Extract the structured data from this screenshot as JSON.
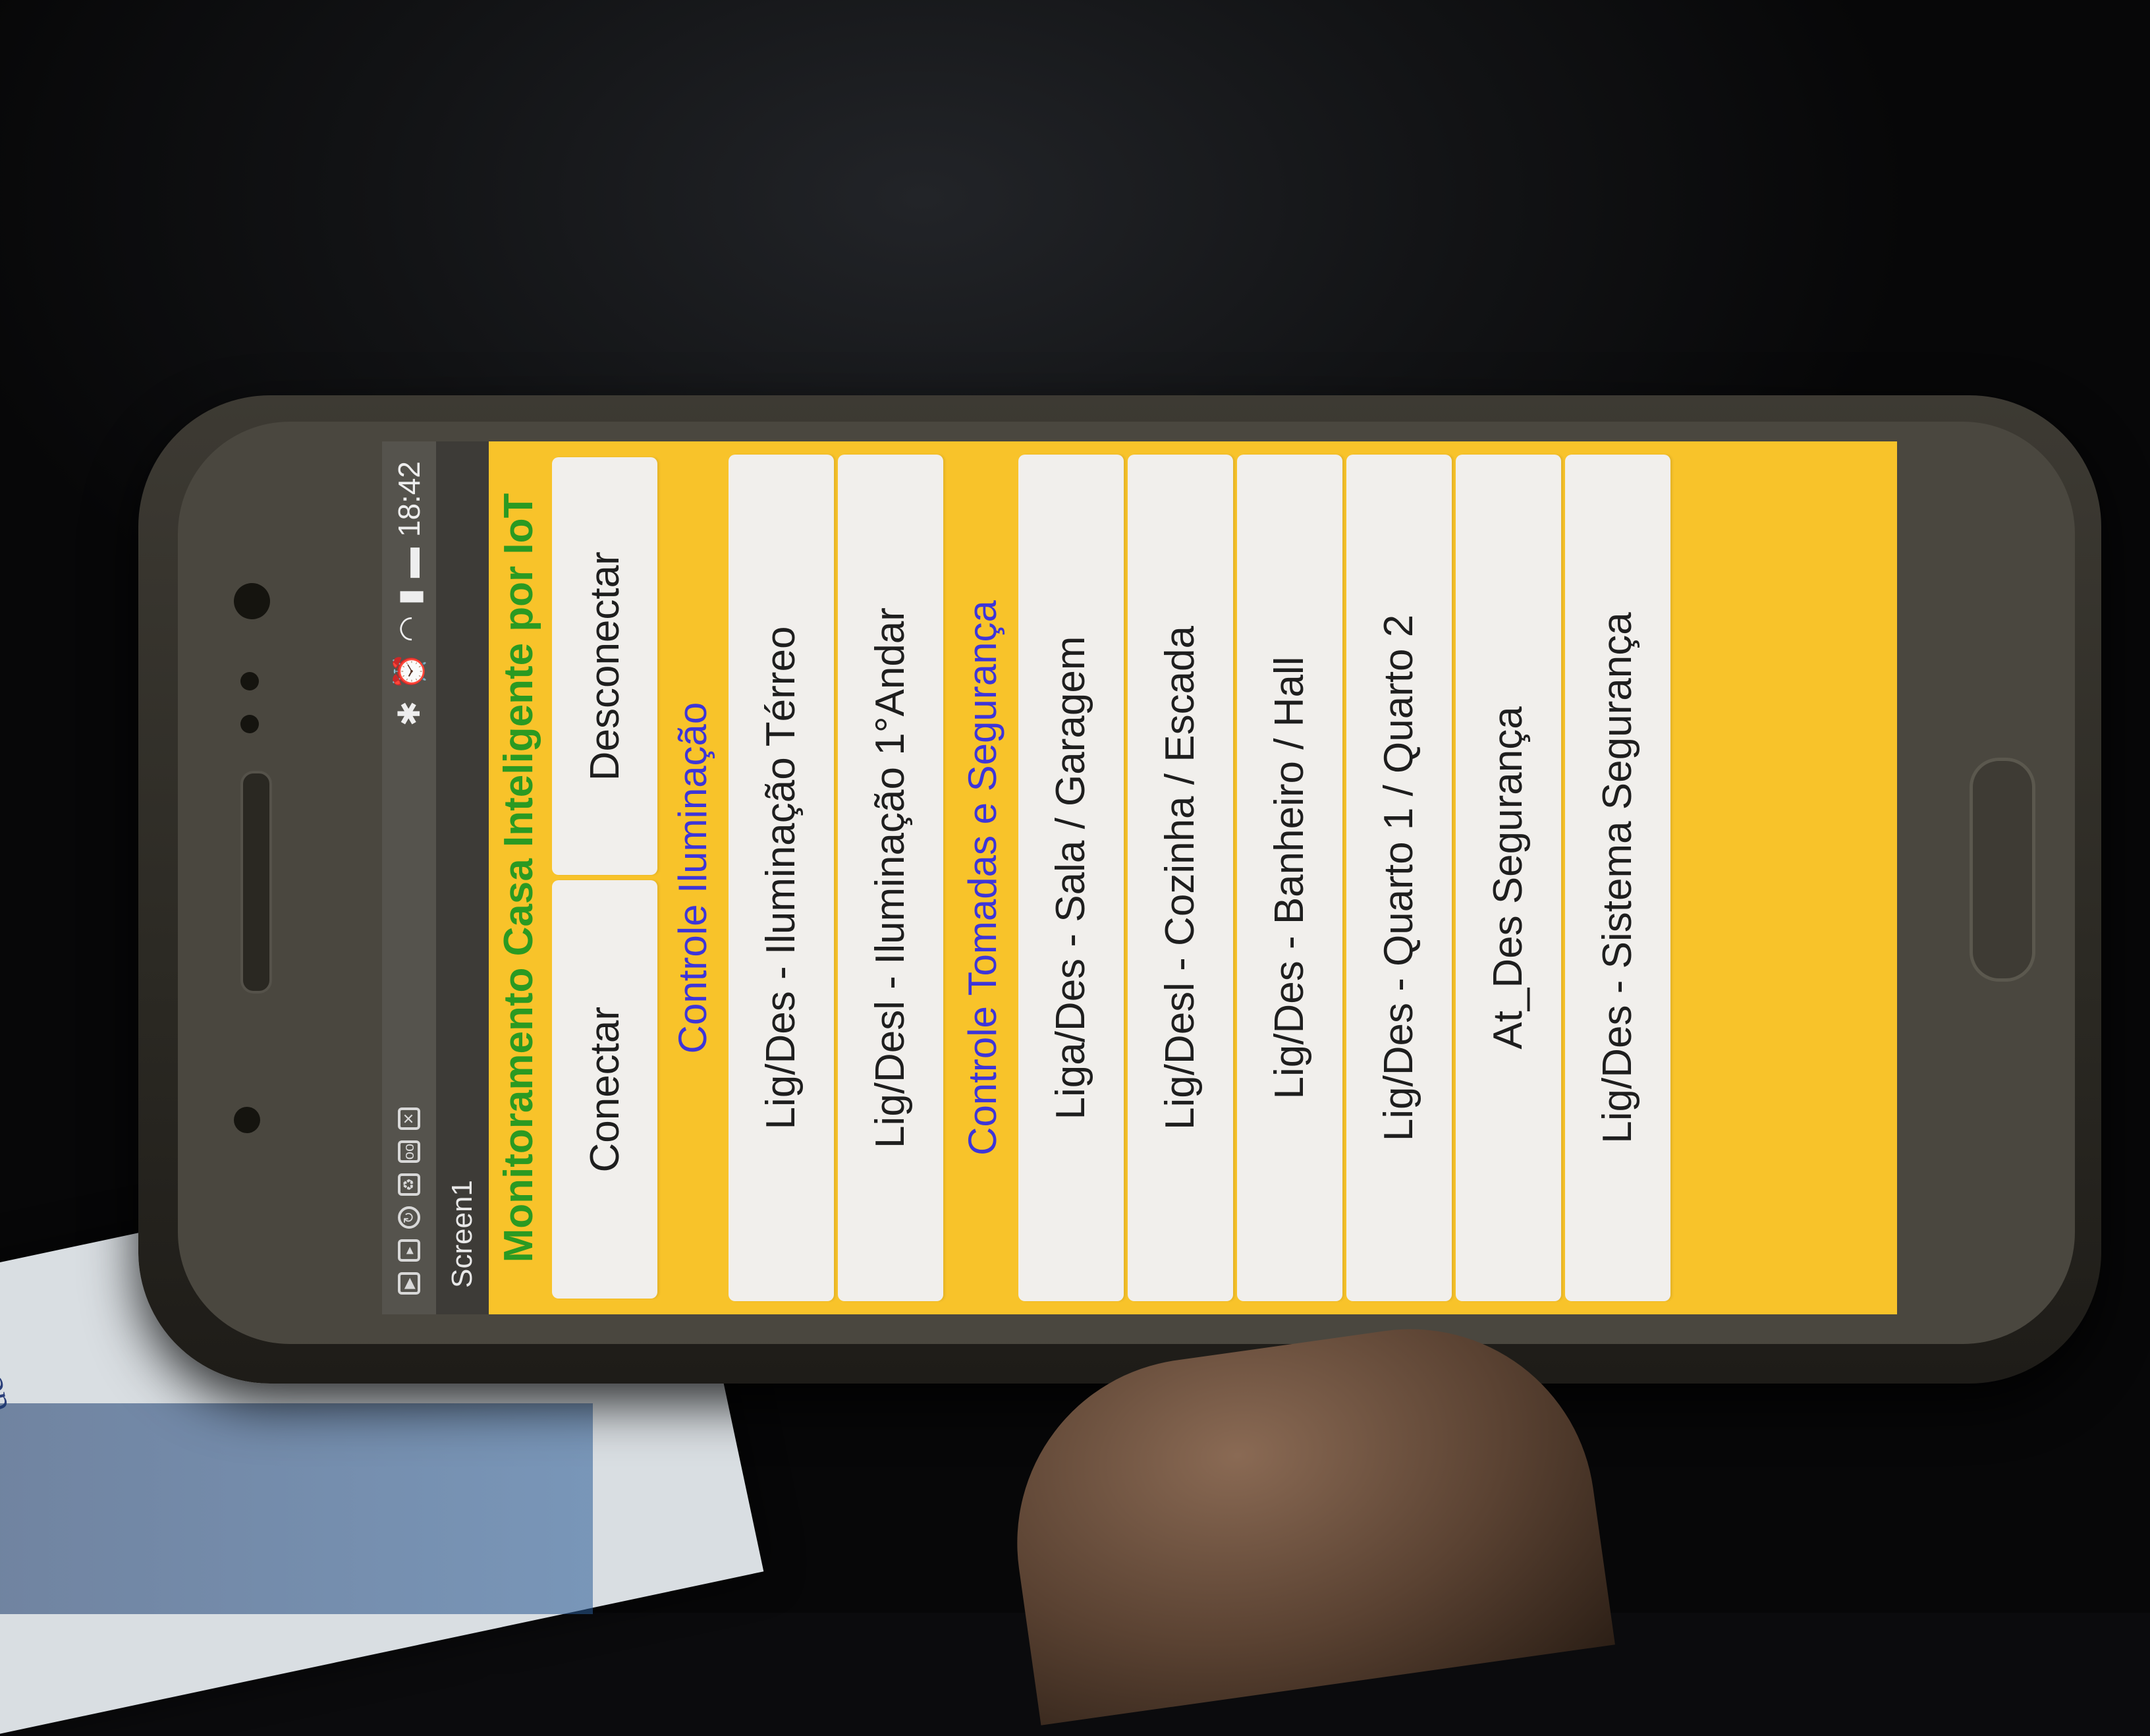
{
  "status_bar": {
    "time": "18:42",
    "icons": [
      "youtube-icon",
      "play-icon",
      "sync-icon",
      "recycle-icon",
      "voicemail-icon",
      "close-icon",
      "bluetooth-icon",
      "alarm-icon",
      "wifi-icon",
      "signal-icon",
      "battery-icon"
    ]
  },
  "titlebar": {
    "title": "Screen1"
  },
  "app": {
    "heading": "Monitoramento Casa Inteligente por IoT",
    "connect_label": "Conectar",
    "disconnect_label": "Desconectar",
    "lighting_section": "Controle Iluminação",
    "lighting_buttons": [
      "Lig/Des - Iluminação Térreo",
      "Lig/Desl - Iluminação 1°Andar"
    ],
    "outlets_section": "Controle Tomadas e Segurança",
    "outlet_buttons": [
      "Liga/Des - Sala / Garagem",
      "Lig/Desl - Cozinha / Escada",
      "Lig/Des - Banheiro / Hall",
      "Lig/Des - Quarto 1 / Quarto 2",
      "At_Des Segurança",
      "Lig/Des - Sistema Segurança"
    ]
  },
  "paper": {
    "text": "de Tomadas"
  },
  "colors": {
    "app_background": "#f8c32a",
    "heading": "#2a9a22",
    "section": "#3d35d9",
    "button": "#f1efec"
  }
}
